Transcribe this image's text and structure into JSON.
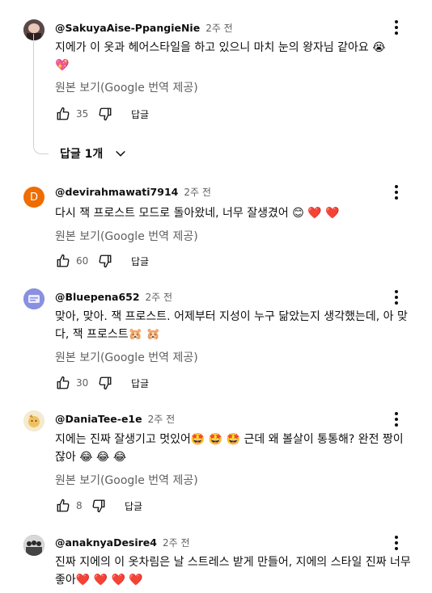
{
  "comments": [
    {
      "handle": "@SakuyaAise-PpangieNie",
      "time": "2주 전",
      "text": "지에가 이 옷과 헤어스타일을 하고 있으니 마치 눈의 왕자님 같아요 😭💖",
      "translate": "원본 보기(Google 번역 제공)",
      "likes": "35",
      "reply": "답글",
      "replies_toggle": "답글 1개",
      "avatar_color": "#6b5a5a",
      "avatar_letter": ""
    },
    {
      "handle": "@devirahmawati7914",
      "time": "2주 전",
      "text": "다시 잭 프로스트 모드로 돌아왔네, 너무 잘생겼어 😊 ❤️ ❤️",
      "translate": "원본 보기(Google 번역 제공)",
      "likes": "60",
      "reply": "답글",
      "avatar_color": "#ef6c00",
      "avatar_letter": "D"
    },
    {
      "handle": "@Bluepena652",
      "time": "2주 전",
      "text": "맞아, 맞아. 잭 프로스트. 어제부터 지성이 누구 닮았는지 생각했는데, 아 맞다, 잭 프로스트🐹 🐹",
      "translate": "원본 보기(Google 번역 제공)",
      "likes": "30",
      "reply": "답글",
      "avatar_color": "#7c83d6",
      "avatar_letter": ""
    },
    {
      "handle": "@DaniaTee-e1e",
      "time": "2주 전",
      "text": "지에는 진짜 잘생기고 멋있어🤩 🤩 🤩  근데 왜 볼살이 통통해? 완전 짱이잖아 😂 😂 😂",
      "translate": "원본 보기(Google 번역 제공)",
      "likes": "8",
      "reply": "답글",
      "avatar_color": "#f2e6b8",
      "avatar_letter": ""
    },
    {
      "handle": "@anaknyaDesire4",
      "time": "2주 전",
      "text": "진짜 지에의 이 옷차림은 날 스트레스 받게 만들어, 지에의 스타일 진짜 너무 좋아❤️ ❤️ ❤️ ❤️",
      "avatar_color": "#3a3a3a",
      "avatar_letter": ""
    }
  ],
  "icons": {
    "like": "thumb-up-icon",
    "dislike": "thumb-down-icon",
    "more": "more-vert-icon",
    "expand": "chevron-down-icon"
  }
}
